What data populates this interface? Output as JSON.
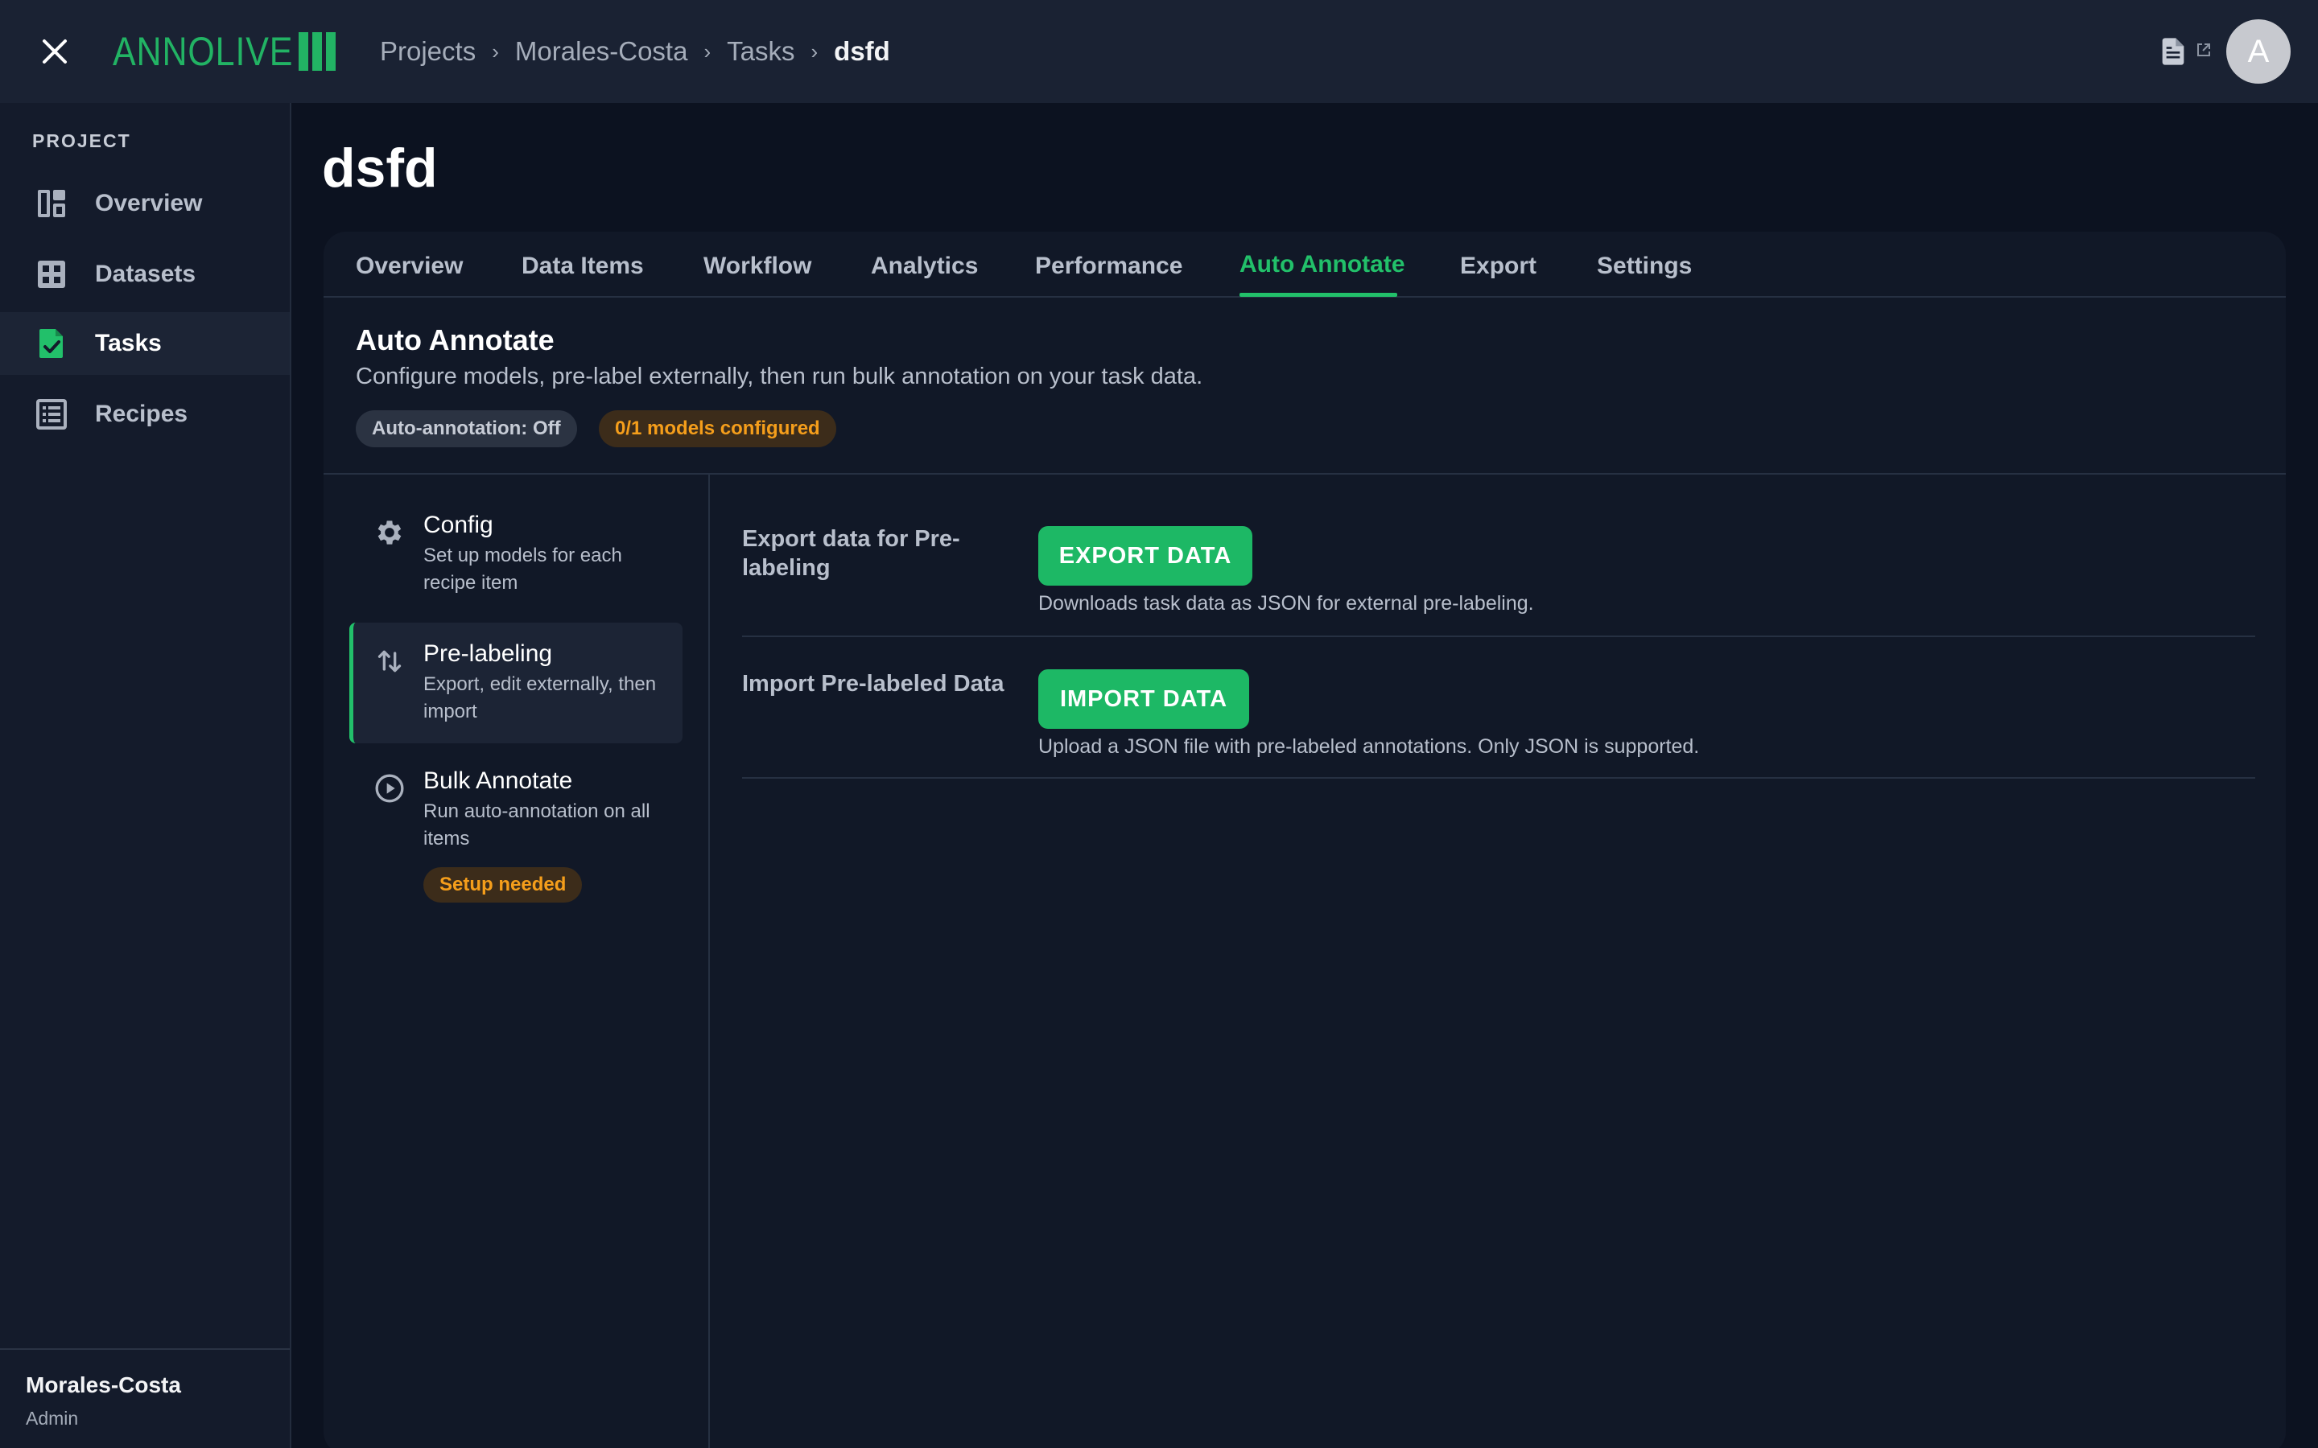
{
  "header": {
    "logo_text": "ANNOLIVE",
    "breadcrumb": [
      "Projects",
      "Morales-Costa",
      "Tasks",
      "dsfd"
    ],
    "avatar_initial": "A"
  },
  "sidebar": {
    "heading": "PROJECT",
    "items": [
      {
        "label": "Overview",
        "icon": "dashboard-icon",
        "active": false
      },
      {
        "label": "Datasets",
        "icon": "grid-icon",
        "active": false
      },
      {
        "label": "Tasks",
        "icon": "task-check-icon",
        "active": true
      },
      {
        "label": "Recipes",
        "icon": "list-icon",
        "active": false
      }
    ],
    "footer": {
      "name": "Morales-Costa",
      "role": "Admin"
    }
  },
  "page": {
    "title": "dsfd",
    "tabs": [
      "Overview",
      "Data Items",
      "Workflow",
      "Analytics",
      "Performance",
      "Auto Annotate",
      "Export",
      "Settings"
    ],
    "active_tab": "Auto Annotate"
  },
  "auto_annotate": {
    "title": "Auto Annotate",
    "description": "Configure models, pre-label externally, then run bulk annotation on your task data.",
    "badges": {
      "status": "Auto-annotation: Off",
      "models": "0/1 models configured"
    },
    "steps": [
      {
        "title": "Config",
        "desc": "Set up models for each recipe item",
        "icon": "gear-icon",
        "active": false
      },
      {
        "title": "Pre-labeling",
        "desc": "Export, edit externally, then import",
        "icon": "swap-vertical-icon",
        "active": true
      },
      {
        "title": "Bulk Annotate",
        "desc": "Run auto-annotation on all items",
        "icon": "play-circle-icon",
        "active": false,
        "badge": "Setup needed"
      }
    ],
    "rows": [
      {
        "label": "Export data for Pre-labeling",
        "button": "EXPORT DATA",
        "help": "Downloads task data as JSON for external pre-labeling."
      },
      {
        "label": "Import Pre-labeled Data",
        "button": "IMPORT DATA",
        "help": "Upload a JSON file with pre-labeled annotations. Only JSON is supported."
      }
    ]
  },
  "colors": {
    "accent": "#22c06a",
    "warning": "#f59e1b",
    "background": "#0c1220",
    "card": "#111827"
  }
}
